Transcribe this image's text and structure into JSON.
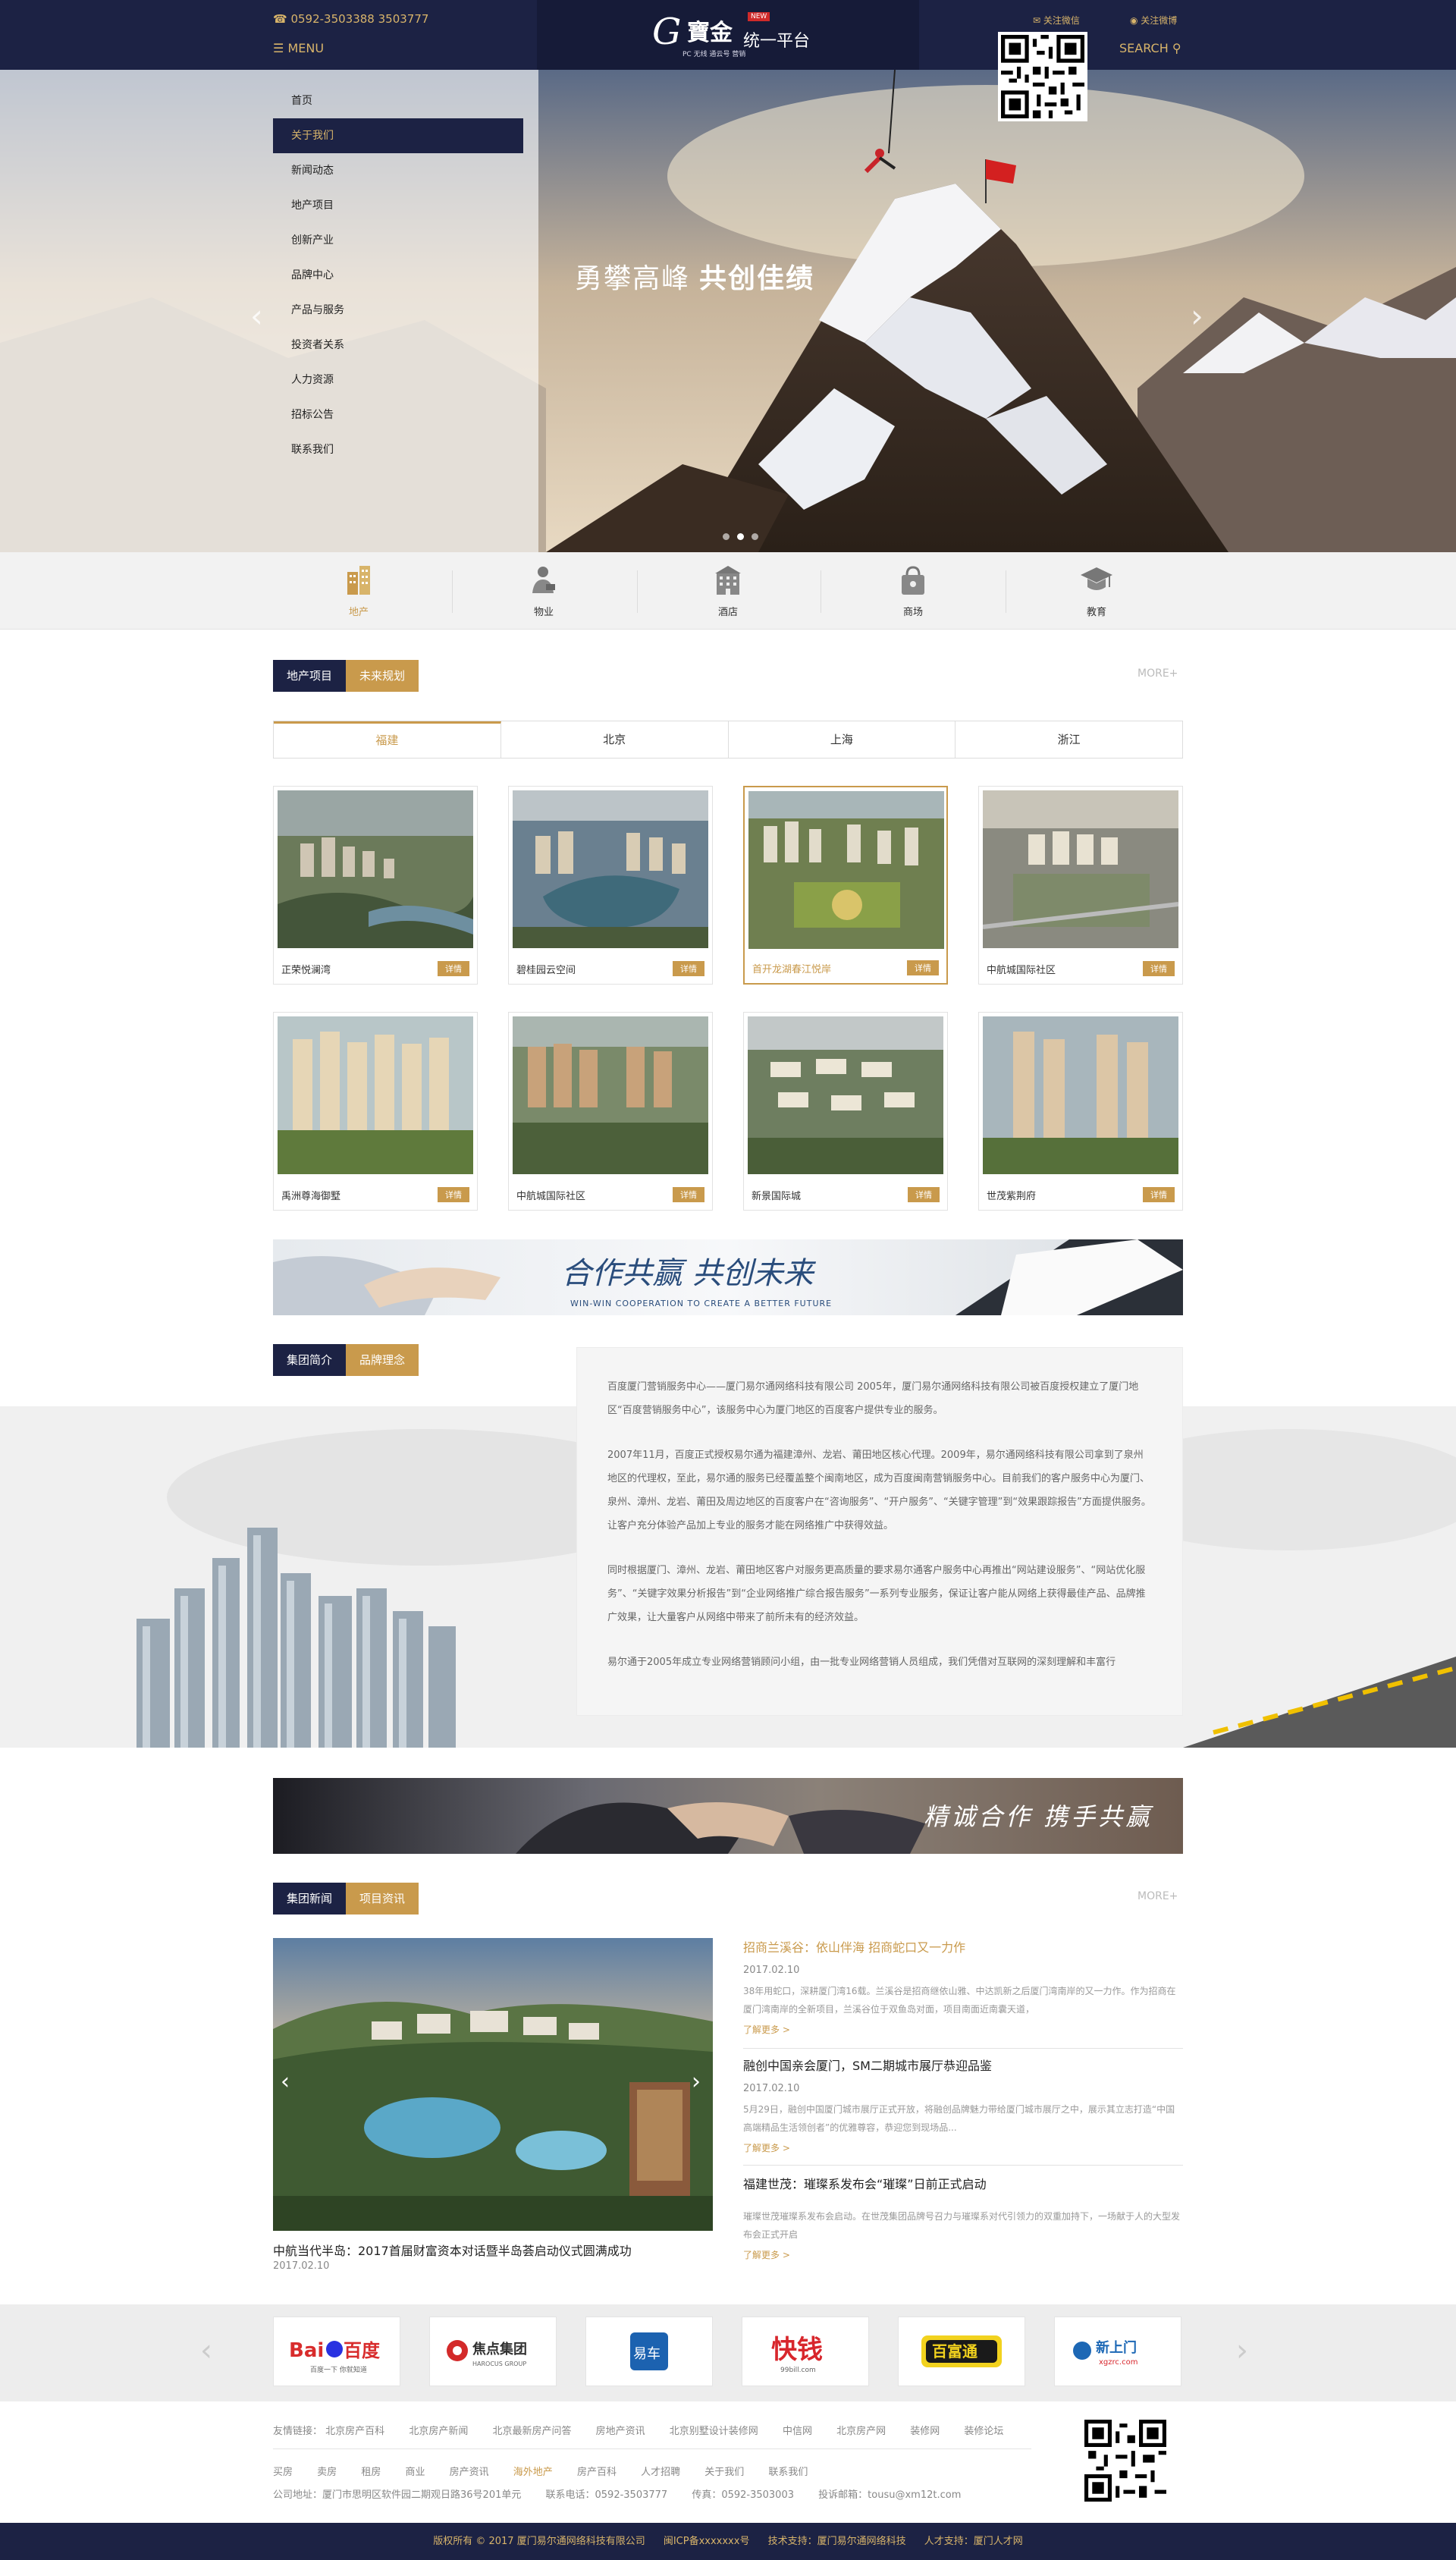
{
  "header": {
    "phone": "0592-3503388 3503777",
    "menu_label": "MENU",
    "search_label": "SEARCH",
    "logo_g": "G",
    "logo_cn": "寶金",
    "logo_new": "NEW",
    "logo_unified": "统一平台",
    "logo_sub": "PC 无线 通云号 营销",
    "follow_wechat": "关注微信",
    "follow_weibo": "关注微博"
  },
  "hero": {
    "slogan_a": "勇攀高峰",
    "slogan_b": "共创佳绩",
    "prev": "‹",
    "next": "›",
    "slides": 3,
    "active_slide": 1
  },
  "side_nav": {
    "items": [
      "首页",
      "关于我们",
      "新闻动态",
      "地产项目",
      "创新产业",
      "品牌中心",
      "产品与服务",
      "投资者关系",
      "人力资源",
      "招标公告",
      "联系我们"
    ],
    "active_index": 1
  },
  "categories": {
    "items": [
      {
        "label": "地产",
        "icon": "building-icon"
      },
      {
        "label": "物业",
        "icon": "concierge-icon"
      },
      {
        "label": "酒店",
        "icon": "hotel-icon"
      },
      {
        "label": "商场",
        "icon": "shopping-bag-icon"
      },
      {
        "label": "教育",
        "icon": "graduation-cap-icon"
      }
    ],
    "active_index": 0
  },
  "projects_section": {
    "tab1": "地产项目",
    "tab2": "未来规划",
    "more": "MORE+",
    "regions": [
      "福建",
      "北京",
      "上海",
      "浙江"
    ],
    "active_region": 0,
    "detail_label": "详情",
    "cards": [
      "正荣悦澜湾",
      "碧桂园云空间",
      "首开龙湖春江悦岸",
      "中航城国际社区",
      "禹洲尊海御墅",
      "中航城国际社区",
      "新景国际城",
      "世茂紫荆府"
    ],
    "highlighted_card": 2
  },
  "banner1": {
    "title": "合作共赢 共创未来",
    "subtitle": "WIN-WIN COOPERATION TO CREATE A BETTER FUTURE"
  },
  "intro_section": {
    "tab1": "集团简介",
    "tab2": "品牌理念",
    "paragraphs": [
      "百度厦门营销服务中心——厦门易尔通网络科技有限公司 2005年，厦门易尔通网络科技有限公司被百度授权建立了厦门地区“百度营销服务中心”，该服务中心为厦门地区的百度客户提供专业的服务。",
      "2007年11月，百度正式授权易尔通为福建漳州、龙岩、莆田地区核心代理。2009年，易尔通网络科技有限公司拿到了泉州地区的代理权，至此，易尔通的服务已经覆盖整个闽南地区，成为百度闽南营销服务中心。目前我们的客户服务中心为厦门、泉州、漳州、龙岩、莆田及周边地区的百度客户在“咨询服务”、“开户服务”、“关键字管理”到“效果跟踪报告”方面提供服务。让客户充分体验产品加上专业的服务才能在网络推广中获得效益。",
      "同时根据厦门、漳州、龙岩、莆田地区客户对服务更高质量的要求易尔通客户服务中心再推出“网站建设服务”、“网站优化服务”、“关键字效果分析报告”到“企业网络推广综合报告服务”一系列专业服务，保证让客户能从网络上获得最佳产品、品牌推广效果，让大量客户从网络中带来了前所未有的经济效益。",
      "易尔通于2005年成立专业网络营销顾问小组，由一批专业网络营销人员组成，我们凭借对互联网的深刻理解和丰富行"
    ]
  },
  "banner2": {
    "title": "精诚合作 携手共赢"
  },
  "news_section": {
    "tab1": "集团新闻",
    "tab2": "项目资讯",
    "more": "MORE+",
    "photo_caption": "中航当代半岛：2017首届财富资本对话暨半岛荟启动仪式圆满成功",
    "photo_date": "2017.02.10",
    "read_more": "了解更多 >",
    "items": [
      {
        "title": "招商兰溪谷：依山伴海 招商蛇口又一力作",
        "date": "2017.02.10",
        "summary": "38年用蛇口，深耕厦门湾16载。兰溪谷是招商继依山雅、中达凯新之后厦门湾南岸的又一力作。作为招商在厦门湾南岸的全新项目，兰溪谷位于双鱼岛对面，项目南面近南囊天道，"
      },
      {
        "title": "融创中国亲会厦门，SM二期城市展厅恭迎品鉴",
        "date": "2017.02.10",
        "summary": "5月29日，融创中国厦门城市展厅正式开放，将融创品牌魅力带给厦门城市展厅之中，展示其立志打造“中国高端精品生活领创者”的优雅尊容，恭迎您到现场品..."
      },
      {
        "title": "福建世茂：璀璨系发布会“璀璨”日前正式启动",
        "date": "2017.02.10",
        "summary": "璀璨世茂璀璨系发布会启动。在世茂集团品牌号召力与璀璨系对代引领力的双重加持下，一场献于人的大型发布会正式开启"
      }
    ]
  },
  "partners": {
    "prev": "‹",
    "next": "›",
    "items": [
      {
        "name": "Bai度百度",
        "sub": "百度一下 你就知道",
        "color": "#2932e1"
      },
      {
        "name": "焦点集团",
        "sub": "HAROCUS GROUP",
        "color": "#d32a2a"
      },
      {
        "name": "易车网",
        "sub": "",
        "color": "#1c62b0"
      },
      {
        "name": "快钱",
        "sub": "99bill.com",
        "color": "#d8262c"
      },
      {
        "name": "百富通",
        "sub": "",
        "color": "#1a1a1a"
      },
      {
        "name": "新上门",
        "sub": "xgzrc.com",
        "color": "#1d68b5"
      }
    ]
  },
  "footer": {
    "friend_links_label": "友情链接：",
    "friend_links": [
      "北京房产百科",
      "北京房产新闻",
      "北京最新房产问答",
      "房地产资讯",
      "北京别墅设计装修网",
      "中信网",
      "北京房产网",
      "装修网",
      "装修论坛"
    ],
    "nav_links": [
      "买房",
      "卖房",
      "租房",
      "商业",
      "房产资讯",
      "海外地产",
      "房产百科",
      "人才招聘",
      "关于我们",
      "联系我们"
    ],
    "nav_highlight": 5,
    "address": "公司地址：厦门市思明区软件园二期观日路36号201单元",
    "tel": "联系电话：0592-3503777",
    "fax": "传真：0592-3503003",
    "email": "投诉邮箱：tousu@xm12t.com",
    "copyright": "版权所有 © 2017 厦门易尔通网络科技有限公司",
    "icp": "闽ICP备xxxxxxx号",
    "tech": "技术支持：厦门易尔通网络科技",
    "talent": "人才支持：厦门人才网"
  },
  "colors": {
    "navy": "#1c2244",
    "gold": "#c99a4c"
  }
}
